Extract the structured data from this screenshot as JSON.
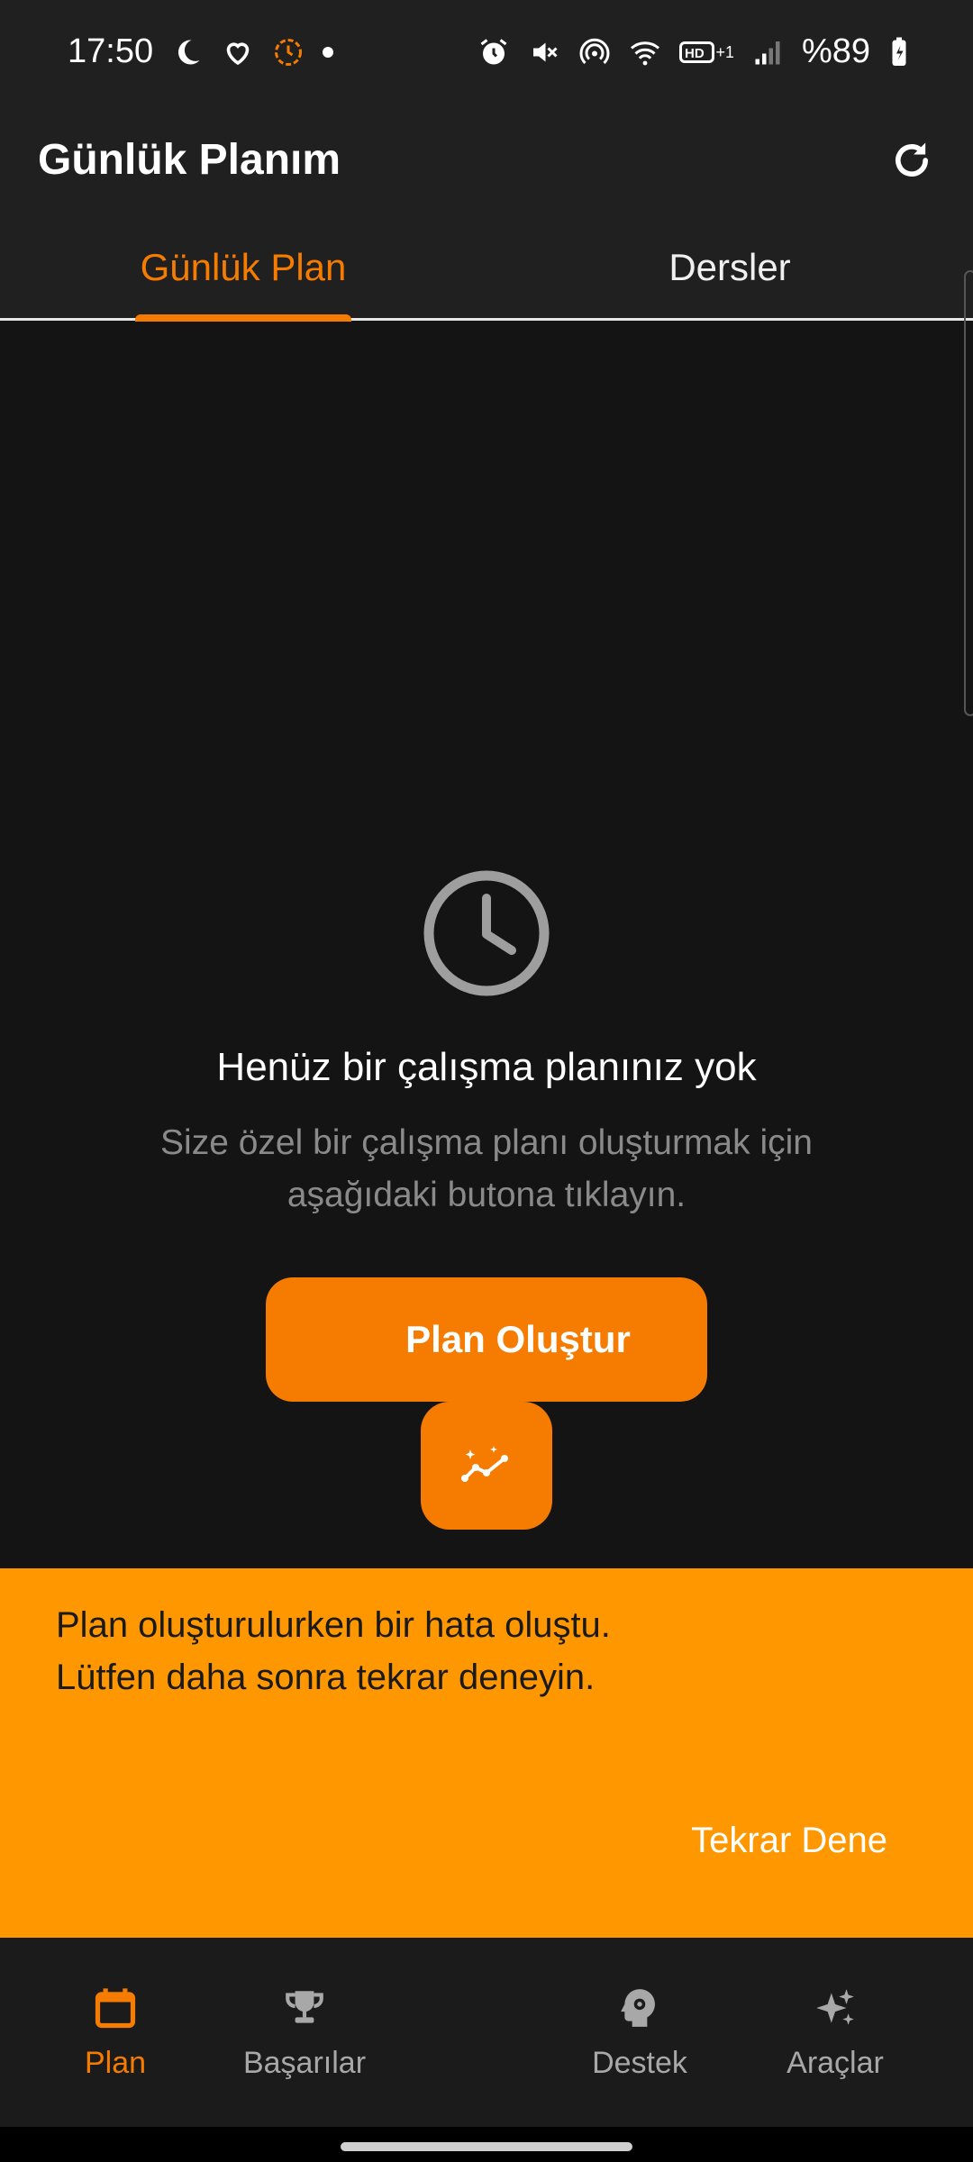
{
  "status_bar": {
    "time": "17:50",
    "battery": "%89",
    "icons": [
      "moon-icon",
      "heart-icon",
      "timer-icon",
      "dot-icon",
      "alarm-icon",
      "mute-icon",
      "hotspot-icon",
      "wifi-icon",
      "hd-plus-icon",
      "signal-icon",
      "battery-charging-icon"
    ]
  },
  "app_bar": {
    "title": "Günlük Planım",
    "action_icon": "refresh-icon"
  },
  "tabs": [
    {
      "label": "Günlük Plan",
      "selected": true
    },
    {
      "label": "Dersler",
      "selected": false
    }
  ],
  "empty_state": {
    "icon": "clock-icon",
    "title": "Henüz bir çalışma planınız yok",
    "subtitle": "Size özel bir çalışma planı oluşturmak için aşağıdaki butona tıklayın."
  },
  "primary_button": {
    "label": "Plan Oluştur"
  },
  "fab": {
    "icon": "sparkle-chart-icon"
  },
  "snackbar": {
    "message": "Plan oluşturulurken bir hata oluştu. Lütfen daha sonra tekrar deneyin.",
    "action": "Tekrar Dene"
  },
  "bottom_nav": {
    "items": [
      {
        "label": "Plan",
        "icon": "calendar-icon",
        "active": true
      },
      {
        "label": "Başarılar",
        "icon": "trophy-icon",
        "active": false
      },
      {
        "label": "Destek",
        "icon": "head-gear-icon",
        "active": false
      },
      {
        "label": "Araçlar",
        "icon": "sparkles-icon",
        "active": false
      }
    ]
  },
  "colors": {
    "accent": "#f57c00",
    "snackbar": "#ff9800",
    "background": "#141414",
    "surface": "#202020"
  }
}
